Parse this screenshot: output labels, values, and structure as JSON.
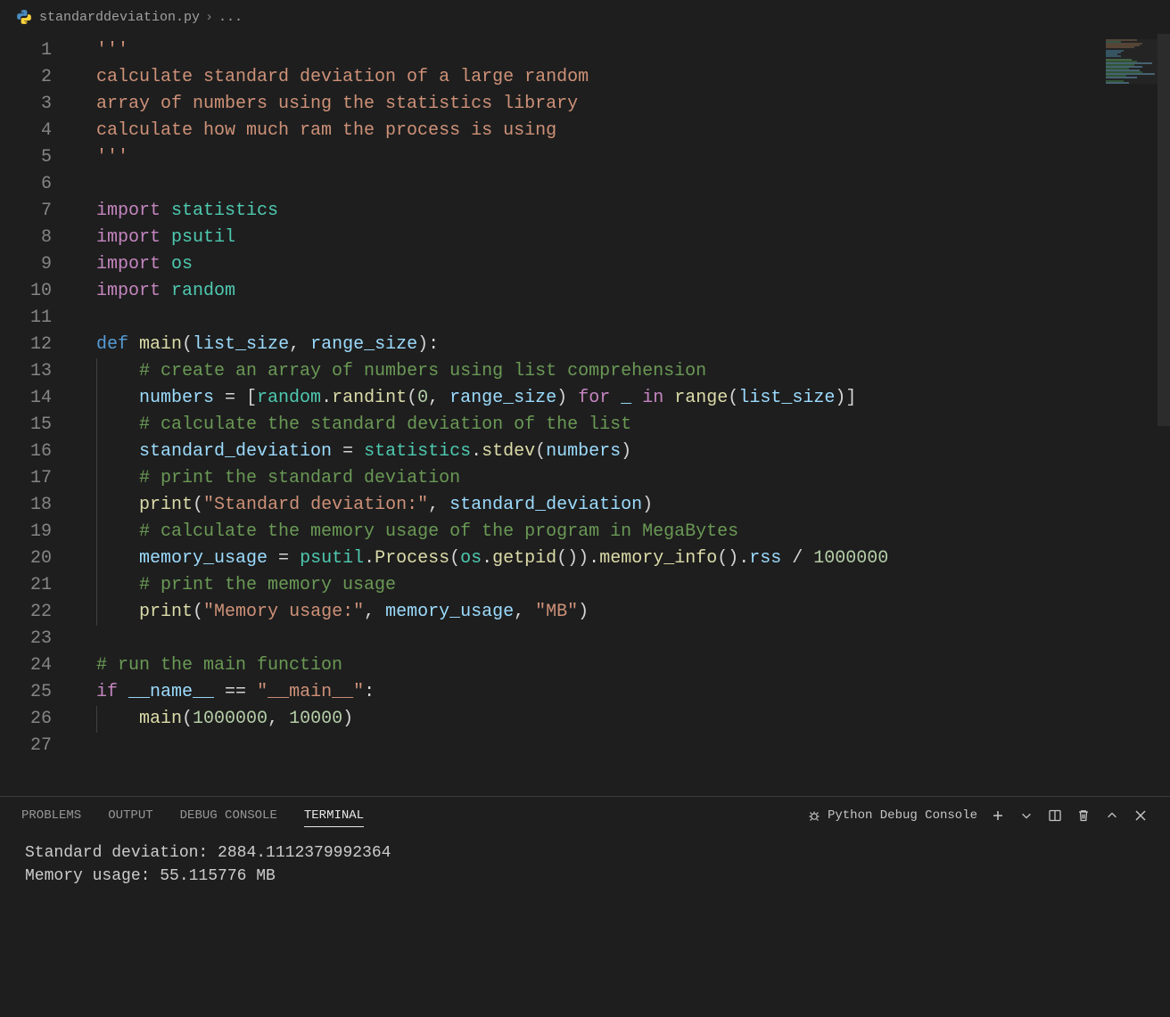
{
  "breadcrumb": {
    "filename": "standarddeviation.py",
    "rest": "..."
  },
  "editor": {
    "lines": [
      {
        "n": 1,
        "tokens": [
          [
            "str",
            "'''"
          ]
        ]
      },
      {
        "n": 2,
        "tokens": [
          [
            "str",
            "calculate standard deviation of a large random"
          ]
        ]
      },
      {
        "n": 3,
        "tokens": [
          [
            "str",
            "array of numbers using the statistics library"
          ]
        ]
      },
      {
        "n": 4,
        "tokens": [
          [
            "str",
            "calculate how much ram the process is using"
          ]
        ]
      },
      {
        "n": 5,
        "tokens": [
          [
            "str",
            "'''"
          ]
        ]
      },
      {
        "n": 6,
        "tokens": []
      },
      {
        "n": 7,
        "tokens": [
          [
            "kw",
            "import "
          ],
          [
            "mod",
            "statistics"
          ]
        ]
      },
      {
        "n": 8,
        "tokens": [
          [
            "kw",
            "import "
          ],
          [
            "mod",
            "psutil"
          ]
        ]
      },
      {
        "n": 9,
        "tokens": [
          [
            "kw",
            "import "
          ],
          [
            "mod",
            "os"
          ]
        ]
      },
      {
        "n": 10,
        "tokens": [
          [
            "kw",
            "import "
          ],
          [
            "mod",
            "random"
          ]
        ]
      },
      {
        "n": 11,
        "tokens": []
      },
      {
        "n": 12,
        "tokens": [
          [
            "kw2",
            "def "
          ],
          [
            "fn",
            "main"
          ],
          [
            "op",
            "("
          ],
          [
            "var",
            "list_size"
          ],
          [
            "op",
            ", "
          ],
          [
            "var",
            "range_size"
          ],
          [
            "op",
            "):"
          ]
        ]
      },
      {
        "n": 13,
        "indent": 1,
        "tokens": [
          [
            "com",
            "# create an array of numbers using list comprehension"
          ]
        ]
      },
      {
        "n": 14,
        "indent": 1,
        "tokens": [
          [
            "var",
            "numbers"
          ],
          [
            "op",
            " = ["
          ],
          [
            "mod",
            "random"
          ],
          [
            "op",
            "."
          ],
          [
            "fn",
            "randint"
          ],
          [
            "op",
            "("
          ],
          [
            "num",
            "0"
          ],
          [
            "op",
            ", "
          ],
          [
            "var",
            "range_size"
          ],
          [
            "op",
            ") "
          ],
          [
            "kw",
            "for"
          ],
          [
            "op",
            " "
          ],
          [
            "var",
            "_"
          ],
          [
            "op",
            " "
          ],
          [
            "kw",
            "in"
          ],
          [
            "op",
            " "
          ],
          [
            "fn",
            "range"
          ],
          [
            "op",
            "("
          ],
          [
            "var",
            "list_size"
          ],
          [
            "op",
            ")]"
          ]
        ]
      },
      {
        "n": 15,
        "indent": 1,
        "tokens": [
          [
            "com",
            "# calculate the standard deviation of the list"
          ]
        ]
      },
      {
        "n": 16,
        "indent": 1,
        "tokens": [
          [
            "var",
            "standard_deviation"
          ],
          [
            "op",
            " = "
          ],
          [
            "mod",
            "statistics"
          ],
          [
            "op",
            "."
          ],
          [
            "fn",
            "stdev"
          ],
          [
            "op",
            "("
          ],
          [
            "var",
            "numbers"
          ],
          [
            "op",
            ")"
          ]
        ]
      },
      {
        "n": 17,
        "indent": 1,
        "tokens": [
          [
            "com",
            "# print the standard deviation"
          ]
        ]
      },
      {
        "n": 18,
        "indent": 1,
        "tokens": [
          [
            "fn",
            "print"
          ],
          [
            "op",
            "("
          ],
          [
            "str",
            "\"Standard deviation:\""
          ],
          [
            "op",
            ", "
          ],
          [
            "var",
            "standard_deviation"
          ],
          [
            "op",
            ")"
          ]
        ]
      },
      {
        "n": 19,
        "indent": 1,
        "tokens": [
          [
            "com",
            "# calculate the memory usage of the program in MegaBytes"
          ]
        ]
      },
      {
        "n": 20,
        "indent": 1,
        "tokens": [
          [
            "var",
            "memory_usage"
          ],
          [
            "op",
            " = "
          ],
          [
            "mod",
            "psutil"
          ],
          [
            "op",
            "."
          ],
          [
            "fn",
            "Process"
          ],
          [
            "op",
            "("
          ],
          [
            "mod",
            "os"
          ],
          [
            "op",
            "."
          ],
          [
            "fn",
            "getpid"
          ],
          [
            "op",
            "())."
          ],
          [
            "fn",
            "memory_info"
          ],
          [
            "op",
            "()."
          ],
          [
            "var",
            "rss"
          ],
          [
            "op",
            " / "
          ],
          [
            "num",
            "1000000"
          ]
        ]
      },
      {
        "n": 21,
        "indent": 1,
        "tokens": [
          [
            "com",
            "# print the memory usage"
          ]
        ]
      },
      {
        "n": 22,
        "indent": 1,
        "tokens": [
          [
            "fn",
            "print"
          ],
          [
            "op",
            "("
          ],
          [
            "str",
            "\"Memory usage:\""
          ],
          [
            "op",
            ", "
          ],
          [
            "var",
            "memory_usage"
          ],
          [
            "op",
            ", "
          ],
          [
            "str",
            "\"MB\""
          ],
          [
            "op",
            ")"
          ]
        ]
      },
      {
        "n": 23,
        "tokens": []
      },
      {
        "n": 24,
        "tokens": [
          [
            "com",
            "# run the main function"
          ]
        ]
      },
      {
        "n": 25,
        "tokens": [
          [
            "kw",
            "if"
          ],
          [
            "op",
            " "
          ],
          [
            "var",
            "__name__"
          ],
          [
            "op",
            " == "
          ],
          [
            "str",
            "\"__main__\""
          ],
          [
            "op",
            ":"
          ]
        ]
      },
      {
        "n": 26,
        "indent": 1,
        "tokens": [
          [
            "fn",
            "main"
          ],
          [
            "op",
            "("
          ],
          [
            "num",
            "1000000"
          ],
          [
            "op",
            ", "
          ],
          [
            "num",
            "10000"
          ],
          [
            "op",
            ")"
          ]
        ]
      },
      {
        "n": 27,
        "tokens": []
      }
    ]
  },
  "panel": {
    "tabs": {
      "problems": "PROBLEMS",
      "output": "OUTPUT",
      "debug": "DEBUG CONSOLE",
      "terminal": "TERMINAL"
    },
    "active_tab": "terminal",
    "profile_label": "Python Debug Console",
    "output": [
      "Standard deviation: 2884.1112379992364",
      "Memory usage: 55.115776 MB"
    ]
  }
}
